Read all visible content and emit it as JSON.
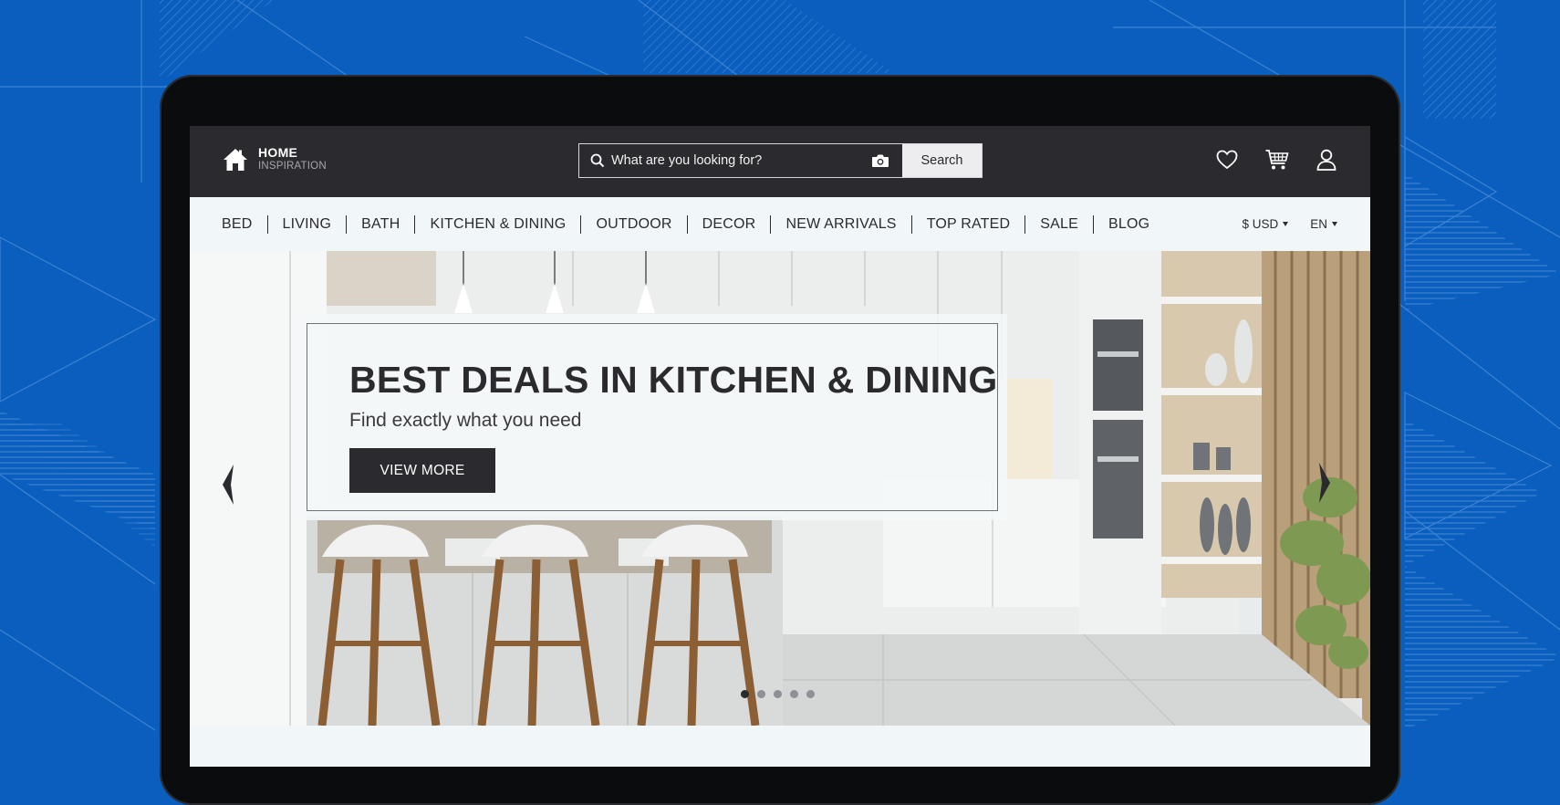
{
  "colors": {
    "page_background": "#0a5fbe",
    "header_dark": "#2b2a2f",
    "nav_background": "#f1f7f8",
    "banner_button": "#2b2a2f"
  },
  "header": {
    "logo_icon": "house-icon",
    "logo_title": "HOME",
    "logo_subtitle": "INSPIRATION",
    "search": {
      "icon": "search-icon",
      "placeholder": "What are you looking for?",
      "camera_icon": "camera-icon",
      "button_label": "Search"
    },
    "icons": [
      "heart-icon",
      "cart-icon",
      "user-icon"
    ]
  },
  "nav": {
    "categories": [
      "BED",
      "LIVING",
      "BATH",
      "KITCHEN & DINING",
      "OUTDOOR",
      "DECOR",
      "NEW ARRIVALS",
      "TOP RATED",
      "SALE",
      "BLOG"
    ],
    "currency": "$ USD",
    "language": "EN"
  },
  "hero": {
    "title": "BEST DEALS IN KITCHEN & DINING",
    "subtitle": "Find exactly what you need",
    "button_label": "VIEW MORE",
    "slides_total": 5,
    "active_slide": 1
  }
}
